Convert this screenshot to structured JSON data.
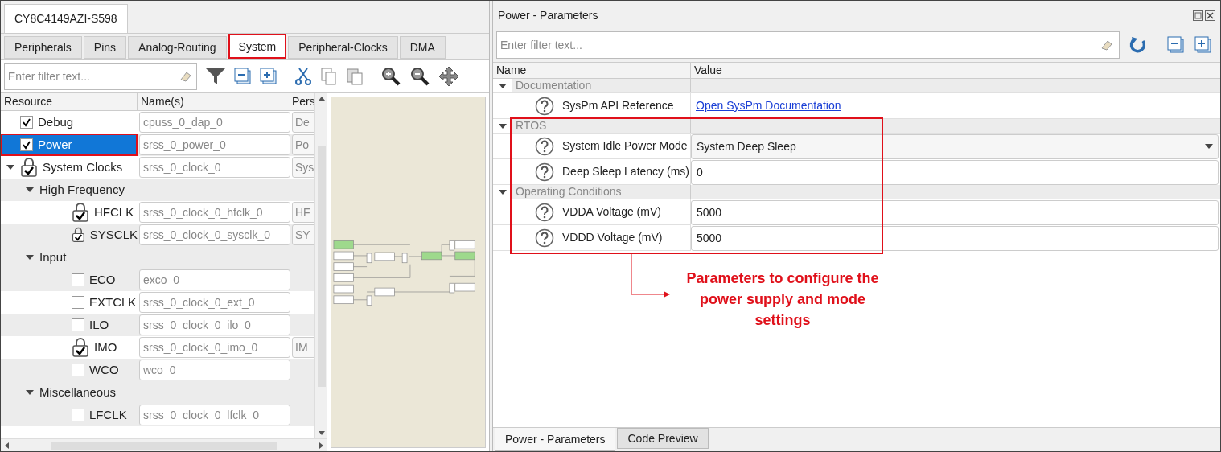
{
  "device_tab": {
    "label": "CY8C4149AZI-S598"
  },
  "tabs": [
    {
      "label": "Peripherals",
      "selected": false,
      "highlighted": false
    },
    {
      "label": "Pins",
      "selected": false,
      "highlighted": false
    },
    {
      "label": "Analog-Routing",
      "selected": false,
      "highlighted": false
    },
    {
      "label": "System",
      "selected": true,
      "highlighted": true
    },
    {
      "label": "Peripheral-Clocks",
      "selected": false,
      "highlighted": false
    },
    {
      "label": "DMA",
      "selected": false,
      "highlighted": false
    }
  ],
  "filter": {
    "placeholder": "Enter filter text..."
  },
  "resources": {
    "columns": [
      "Resource",
      "Name(s)",
      "Pers"
    ],
    "items": [
      {
        "kind": "checkbox",
        "label": "Debug",
        "checked": true,
        "selected": false,
        "highlighted": false,
        "name": "cpuss_0_dap_0",
        "column_3": "De"
      },
      {
        "kind": "checkbox",
        "label": "Power",
        "checked": true,
        "selected": true,
        "highlighted": true,
        "name": "srss_0_power_0",
        "column_3": "Po"
      },
      {
        "kind": "lock",
        "label": "System Clocks",
        "selected": false,
        "highlighted": false,
        "name": "srss_0_clock_0",
        "column_3": "Sys",
        "expanded": true,
        "children": [
          {
            "kind": "group",
            "label": "High Frequency",
            "expanded": true,
            "children": [
              {
                "kind": "lock",
                "label": "HFCLK",
                "selected": false,
                "highlighted": false,
                "name": "srss_0_clock_0_hfclk_0",
                "column_3": "HF"
              },
              {
                "kind": "lock",
                "label": "SYSCLK",
                "selected": false,
                "highlighted": false,
                "name": "srss_0_clock_0_sysclk_0",
                "column_3": "SY"
              }
            ]
          },
          {
            "kind": "group",
            "label": "Input",
            "expanded": true,
            "children": [
              {
                "kind": "checkbox",
                "label": "ECO",
                "checked": false,
                "selected": false,
                "highlighted": false,
                "name": "exco_0"
              },
              {
                "kind": "checkbox",
                "label": "EXTCLK",
                "checked": false,
                "selected": false,
                "highlighted": false,
                "name": "srss_0_clock_0_ext_0"
              },
              {
                "kind": "checkbox",
                "label": "ILO",
                "checked": false,
                "selected": false,
                "highlighted": false,
                "name": "srss_0_clock_0_ilo_0"
              },
              {
                "kind": "lock",
                "label": "IMO",
                "selected": false,
                "highlighted": false,
                "name": "srss_0_clock_0_imo_0",
                "column_3": "IM"
              },
              {
                "kind": "checkbox",
                "label": "WCO",
                "checked": false,
                "selected": false,
                "highlighted": false,
                "name": "wco_0"
              }
            ]
          },
          {
            "kind": "group",
            "label": "Miscellaneous",
            "expanded": true,
            "children": [
              {
                "kind": "checkbox",
                "label": "LFCLK",
                "checked": false,
                "selected": false,
                "highlighted": false,
                "name": "srss_0_clock_0_lfclk_0"
              }
            ]
          }
        ]
      }
    ]
  },
  "parameters_panel": {
    "title": "Power - Parameters",
    "filter": {
      "placeholder": "Enter filter text..."
    },
    "columns": [
      "Name",
      "Value"
    ],
    "groups": [
      {
        "label": "Documentation",
        "expanded": true,
        "children": [
          {
            "kind": "link",
            "name": "SysPm API Reference",
            "value": "Open SysPm Documentation"
          }
        ]
      },
      {
        "label": "RTOS",
        "expanded": true,
        "children": [
          {
            "kind": "dropdown",
            "name": "System Idle Power Mode",
            "value": "System Deep Sleep"
          },
          {
            "kind": "text",
            "name": "Deep Sleep Latency (ms)",
            "value": "0"
          }
        ]
      },
      {
        "label": "Operating Conditions",
        "expanded": true,
        "children": [
          {
            "kind": "text",
            "name": "VDDA Voltage (mV)",
            "value": "5000"
          },
          {
            "kind": "text",
            "name": "VDDD Voltage (mV)",
            "value": "5000"
          }
        ]
      }
    ],
    "bottom_tabs": [
      {
        "label": "Power - Parameters",
        "selected": true
      },
      {
        "label": "Code Preview",
        "selected": false
      }
    ]
  },
  "annotation": {
    "text": "Parameters to configure the power supply and mode settings"
  }
}
